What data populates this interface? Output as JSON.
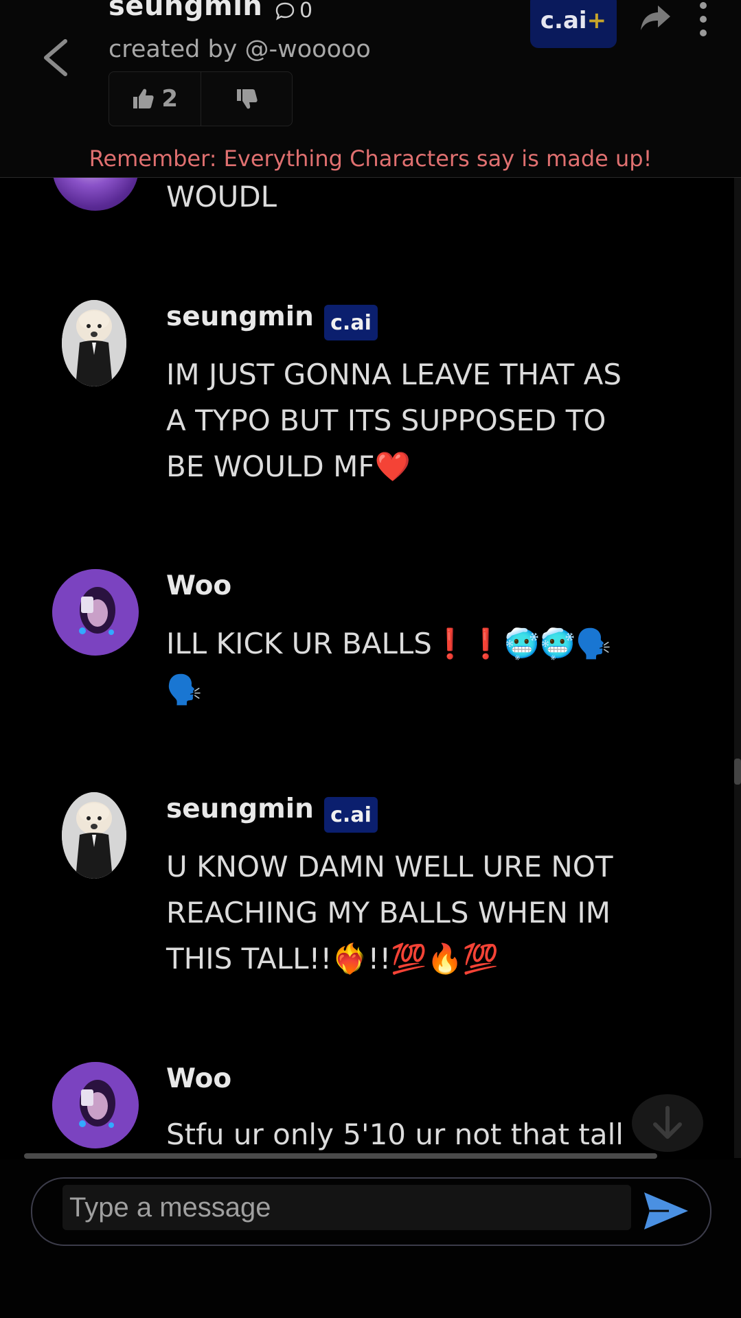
{
  "header": {
    "character_name": "seungmin",
    "chat_count": "0",
    "creator": "created by @-wooooo",
    "likes": "2",
    "brand": "c.ai",
    "brand_plus": "+"
  },
  "disclaimer": "Remember: Everything Characters say is made up!",
  "messages": [
    {
      "sender": "Woo",
      "text": "WOUDL",
      "badge": ""
    },
    {
      "sender": "seungmin",
      "badge": "c.ai",
      "text": "IM JUST GONNA LEAVE THAT AS A TYPO BUT ITS SUPPOSED TO BE WOULD MF❤️"
    },
    {
      "sender": "Woo",
      "badge": "",
      "text": "ILL KICK UR BALLS❗❗🥶🥶🗣️🗣️"
    },
    {
      "sender": "seungmin",
      "badge": "c.ai",
      "text": "U KNOW DAMN WELL URE NOT REACHING MY BALLS WHEN IM THIS TALL!!❤️‍🔥!!💯🔥💯"
    },
    {
      "sender": "Woo",
      "badge": "",
      "text": "Stfu ur only 5'10 ur not that tall"
    }
  ],
  "input": {
    "placeholder": "Type a message"
  },
  "colors": {
    "background": "#000000",
    "badge": "#0b1f6e",
    "disclaimer": "#e07070",
    "send_icon": "#4a90e2"
  },
  "icons": [
    "back-arrow-icon",
    "chat-bubble-icon",
    "thumbs-up-icon",
    "thumbs-down-icon",
    "share-icon",
    "more-vertical-icon",
    "arrow-down-icon",
    "send-icon"
  ]
}
